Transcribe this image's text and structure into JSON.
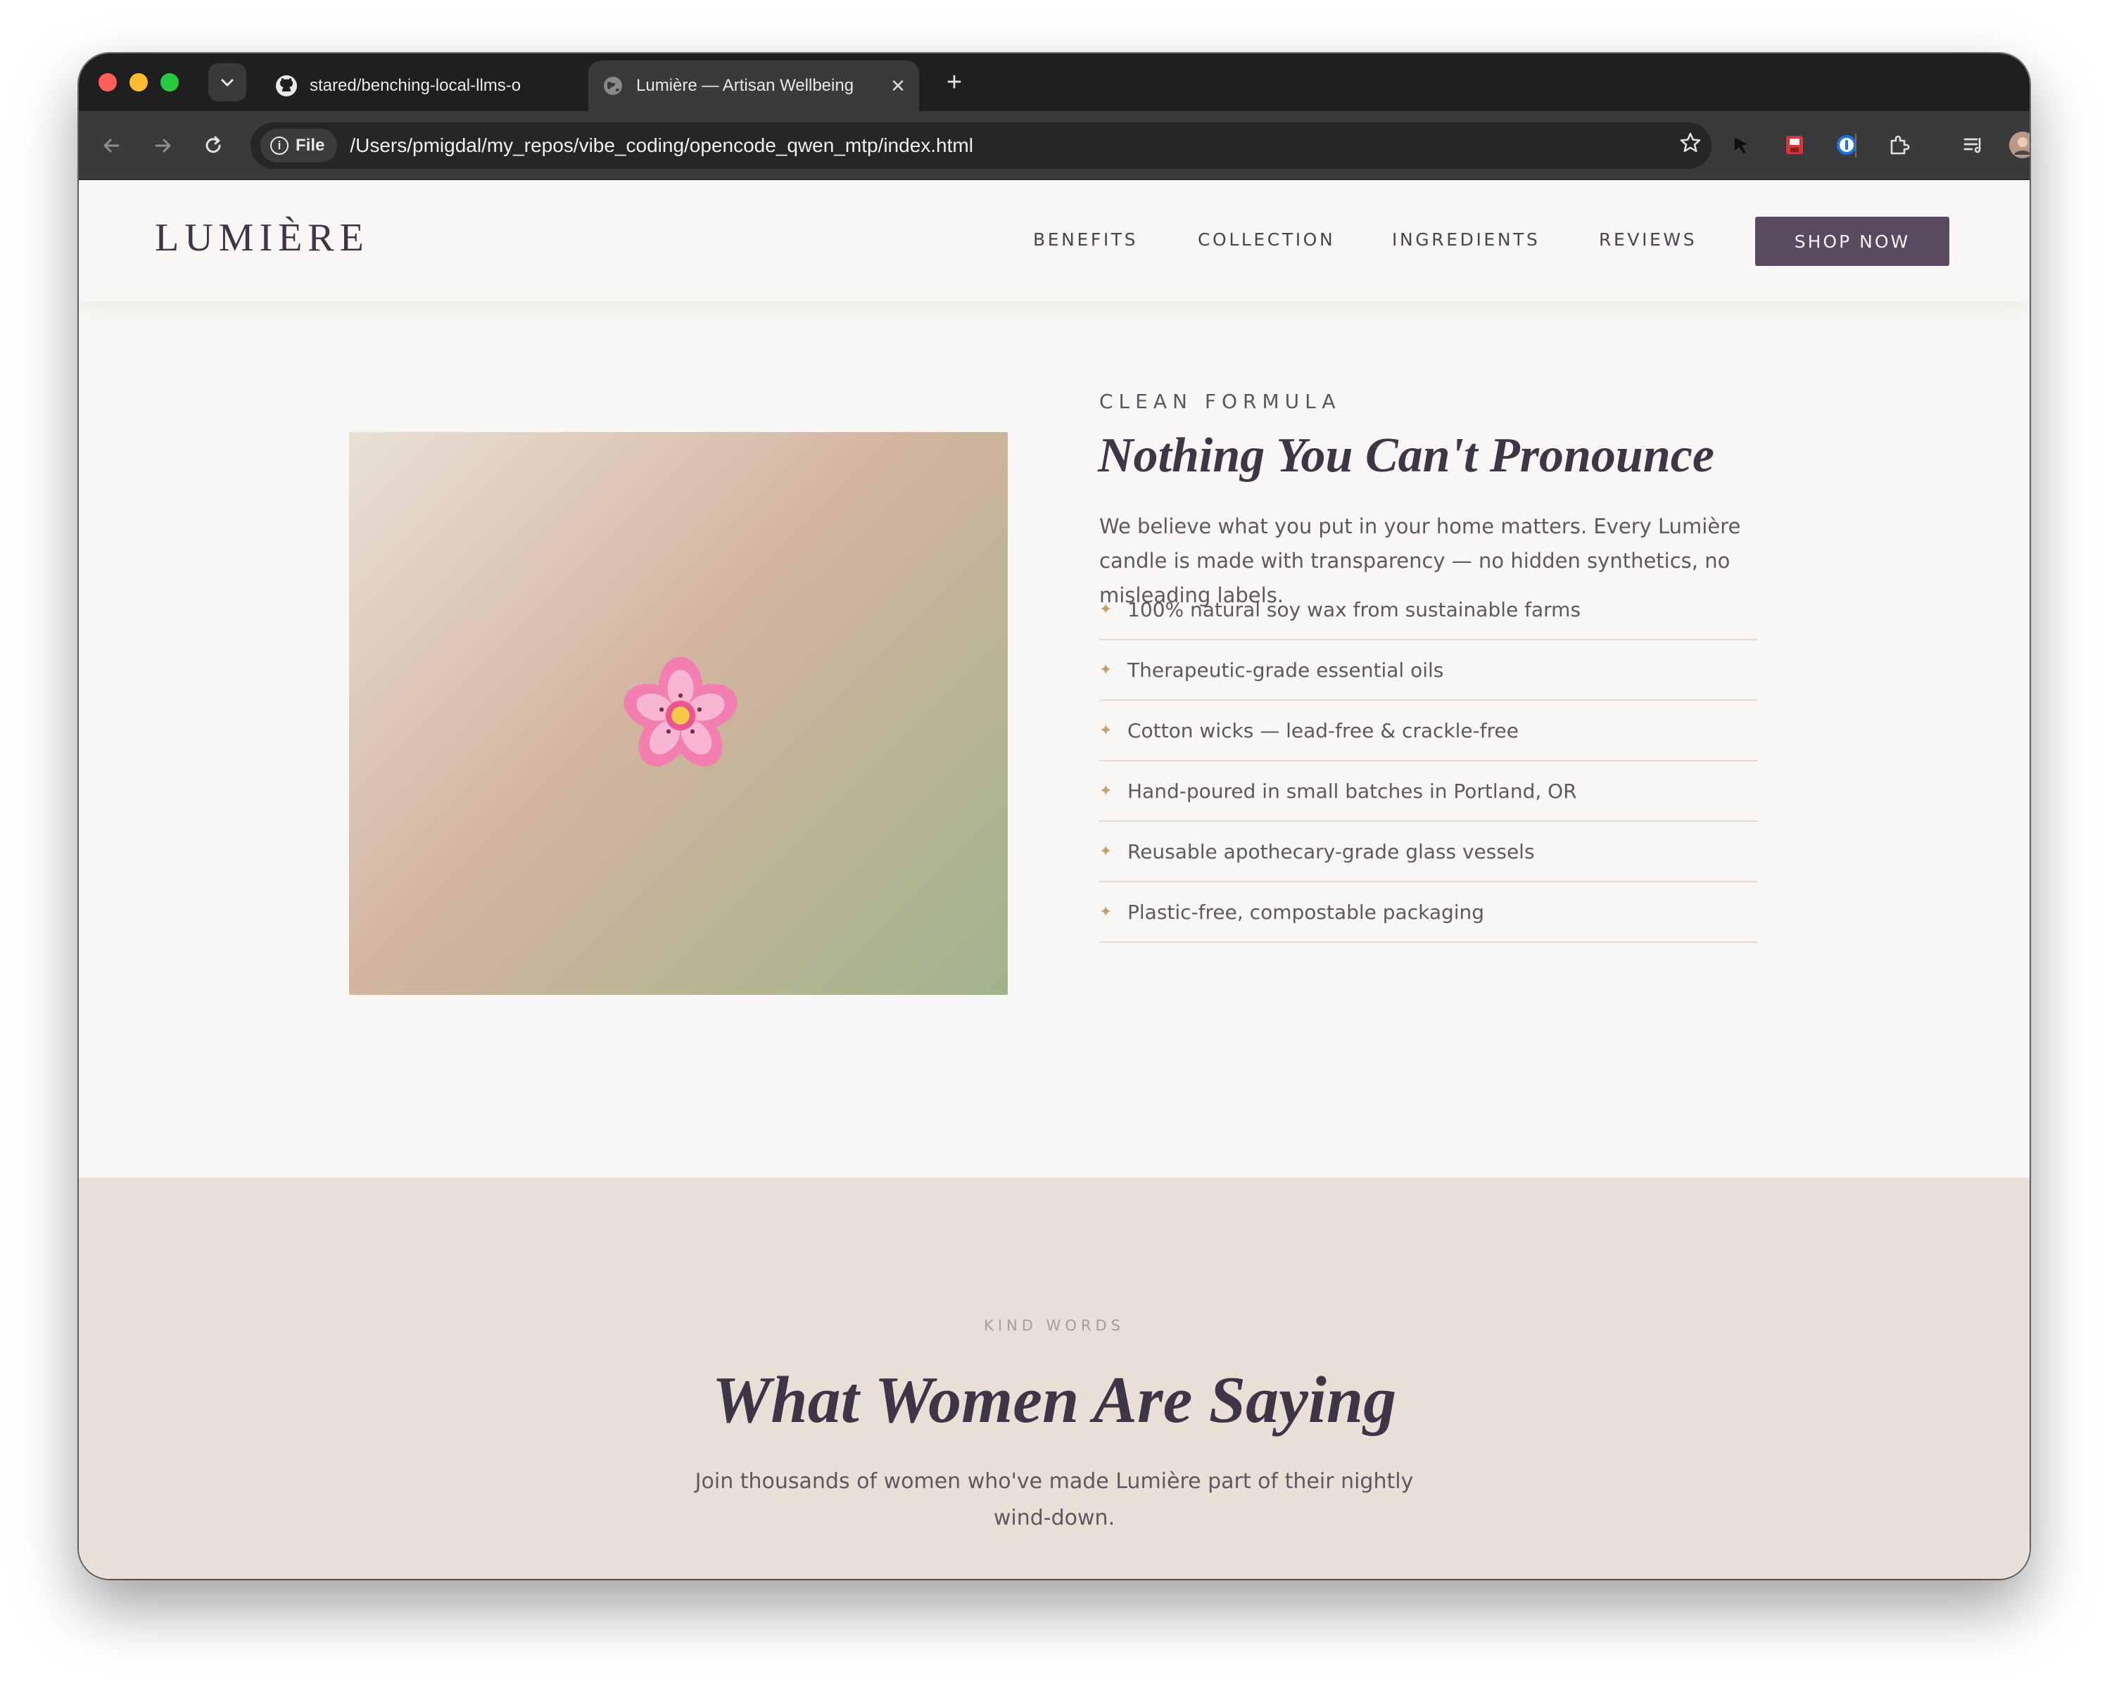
{
  "browser": {
    "tabs": [
      {
        "title": "stared/benching-local-llms-o",
        "active": false,
        "icon": "github-icon"
      },
      {
        "title": "Lumière — Artisan Wellbeing",
        "active": true,
        "icon": "globe-icon"
      }
    ],
    "new_tab_label": "+",
    "close_label": "✕",
    "address_chip": "File",
    "url": "/Users/pmigdal/my_repos/vibe_coding/opencode_qwen_mtp/index.html",
    "extensions": [
      "cursor-icon",
      "save-icon",
      "password-manager-icon",
      "extensions-puzzle-icon",
      "reading-list-icon",
      "profile-avatar"
    ]
  },
  "site": {
    "logo": "LUMIÈRE",
    "nav": [
      "BENEFITS",
      "COLLECTION",
      "INGREDIENTS",
      "REVIEWS"
    ],
    "cta": "SHOP NOW"
  },
  "formula": {
    "eyebrow": "CLEAN FORMULA",
    "heading": "Nothing You Can't Pronounce",
    "lede": "We believe what you put in your home matters. Every Lumière candle is made with transparency — no hidden synthetics, no misleading labels.",
    "bullet": "✦",
    "items": [
      "100% natural soy wax from sustainable farms",
      "Therapeutic-grade essential oils",
      "Cotton wicks — lead-free & crackle-free",
      "Hand-poured in small batches in Portland, OR",
      "Reusable apothecary-grade glass vessels",
      "Plastic-free, compostable packaging"
    ],
    "image_icon": "cherry-blossom-icon"
  },
  "testimonials": {
    "eyebrow": "KIND WORDS",
    "heading": "What Women Are Saying",
    "sub": "Join thousands of women who've made Lumière part of their nightly wind-down."
  },
  "colors": {
    "brand_plum": "#5a4a5f",
    "heading_plum": "#3e3546",
    "gold_bullet": "#c2a268",
    "band_beige": "#e9dfd6",
    "page_bg": "#f8f7f5"
  }
}
